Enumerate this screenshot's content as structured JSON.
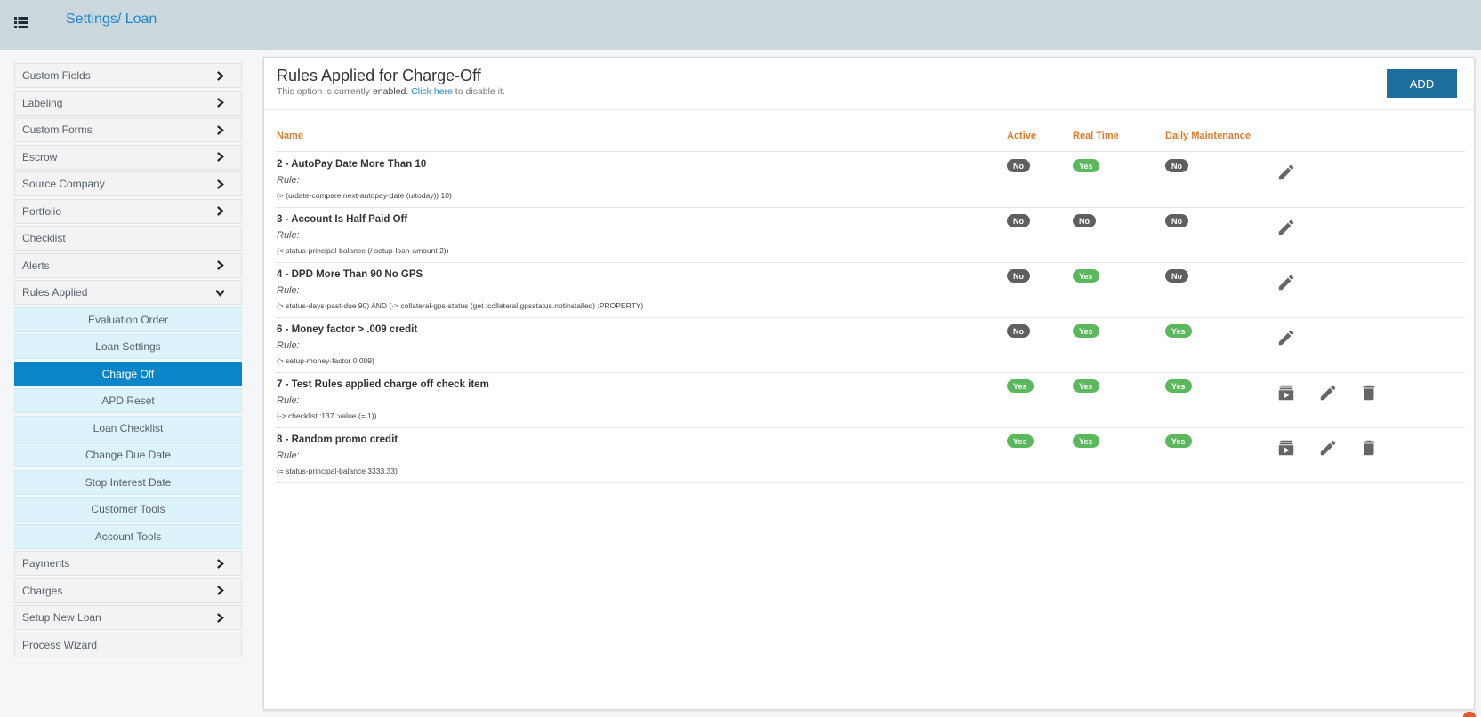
{
  "breadcrumb": {
    "root": "Settings",
    "sep": "/",
    "current": "Loan"
  },
  "sidebar": {
    "items_top": [
      {
        "label": "Custom Fields",
        "chevron": "right"
      },
      {
        "label": "Labeling",
        "chevron": "right"
      },
      {
        "label": "Custom Forms",
        "chevron": "right"
      },
      {
        "label": "Escrow",
        "chevron": "right"
      },
      {
        "label": "Source Company",
        "chevron": "right"
      },
      {
        "label": "Portfolio",
        "chevron": "right"
      },
      {
        "label": "Checklist",
        "chevron": "none"
      },
      {
        "label": "Alerts",
        "chevron": "right"
      },
      {
        "label": "Rules Applied",
        "chevron": "down"
      }
    ],
    "sub_items": [
      {
        "label": "Evaluation Order"
      },
      {
        "label": "Loan Settings"
      },
      {
        "label": "Charge Off",
        "active": true
      },
      {
        "label": "APD Reset"
      },
      {
        "label": "Loan Checklist"
      },
      {
        "label": "Change Due Date"
      },
      {
        "label": "Stop Interest Date"
      },
      {
        "label": "Customer Tools"
      },
      {
        "label": "Account Tools"
      }
    ],
    "items_bottom": [
      {
        "label": "Payments",
        "chevron": "right"
      },
      {
        "label": "Charges",
        "chevron": "right"
      },
      {
        "label": "Setup New Loan",
        "chevron": "right"
      },
      {
        "label": "Process Wizard",
        "chevron": "none"
      }
    ]
  },
  "panel": {
    "title": "Rules Applied for Charge-Off",
    "status_prefix": "This option is currently ",
    "status_value": "enabled.",
    "link_text": "Click here",
    "status_suffix": " to disable it.",
    "add_label": "ADD"
  },
  "table": {
    "columns": {
      "name": "Name",
      "active": "Active",
      "real_time": "Real Time",
      "daily": "Daily Maintenance"
    },
    "rule_label": "Rule:",
    "rows": [
      {
        "name": "2 - AutoPay Date More Than 10",
        "rule": "(> (u/date-compare next-autopay-date (u/today)) 10)",
        "active": "No",
        "real_time": "Yes",
        "daily": "No",
        "actions": [
          "edit"
        ]
      },
      {
        "name": "3 - Account Is Half Paid Off",
        "rule": "(< status-principal-balance (/ setup-loan-amount 2))",
        "active": "No",
        "real_time": "No",
        "daily": "No",
        "actions": [
          "edit"
        ]
      },
      {
        "name": "4 - DPD More Than 90 No GPS",
        "rule": "(> status-days-past-due 90) AND (-> collateral-gps-status (get :collateral.gpsstatus.notinstalled) :PROPERTY)",
        "active": "No",
        "real_time": "Yes",
        "daily": "No",
        "actions": [
          "edit"
        ]
      },
      {
        "name": "6 - Money factor > .009 credit",
        "rule": "(> setup-money-factor 0.009)",
        "active": "No",
        "real_time": "Yes",
        "daily": "Yes",
        "actions": [
          "edit"
        ]
      },
      {
        "name": "7 - Test Rules applied charge off check item",
        "rule": "(-> checklist :137 :value (= 1))",
        "active": "Yes",
        "real_time": "Yes",
        "daily": "Yes",
        "actions": [
          "run",
          "edit",
          "delete"
        ]
      },
      {
        "name": "8 - Random promo credit",
        "rule": "(= status-principal-balance 3333.33)",
        "active": "Yes",
        "real_time": "Yes",
        "daily": "Yes",
        "actions": [
          "run",
          "edit",
          "delete"
        ]
      }
    ]
  },
  "colors": {
    "accent": "#0a85c9",
    "header_text": "#e07a2b",
    "yes": "#5cb85c",
    "no": "#5f5f5f",
    "add_button": "#1f6f9e"
  }
}
